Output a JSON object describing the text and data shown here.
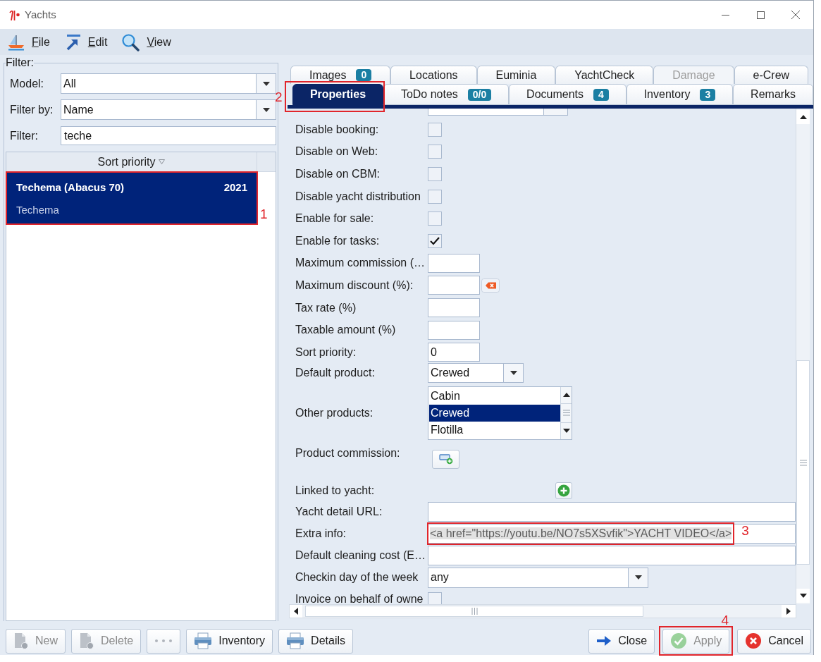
{
  "window": {
    "title": "Yachts"
  },
  "menu": [
    {
      "label": "File",
      "mnemonic": true
    },
    {
      "label": "Edit",
      "mnemonic": true
    },
    {
      "label": "View",
      "mnemonic": true
    }
  ],
  "filter": {
    "title": "Filter:",
    "fields": [
      {
        "kind": "dropdown",
        "label": "Model:",
        "value": "All"
      },
      {
        "kind": "dropdown",
        "label": "Filter by:",
        "value": "Name"
      },
      {
        "kind": "text",
        "label": "Filter:",
        "value": "teche"
      }
    ]
  },
  "yacht_list": {
    "columns": [
      {
        "label": "Sort priority",
        "sorted": true
      }
    ],
    "rows": [
      {
        "name": "Techema (Abacus 70)",
        "year": "2021",
        "subtitle": "Techema",
        "selected": true,
        "callout": "1"
      }
    ]
  },
  "tabs": {
    "back_row": [
      {
        "label": "Images",
        "badge": "0",
        "selected": false,
        "disabled": false
      },
      {
        "label": "Locations",
        "selected": false,
        "disabled": false
      },
      {
        "label": "Euminia",
        "selected": false,
        "disabled": false
      },
      {
        "label": "YachtCheck",
        "selected": false,
        "disabled": false
      },
      {
        "label": "Damage",
        "selected": false,
        "disabled": true
      },
      {
        "label": "e-Crew",
        "selected": false,
        "disabled": false
      }
    ],
    "front_row": [
      {
        "label": "Properties",
        "selected": true,
        "disabled": false,
        "callout": "2"
      },
      {
        "label": "ToDo notes",
        "badge": "0/0",
        "selected": false,
        "disabled": false
      },
      {
        "label": "Documents",
        "badge": "4",
        "selected": false,
        "disabled": false
      },
      {
        "label": "Inventory",
        "badge": "3",
        "selected": false,
        "disabled": false
      },
      {
        "label": "Remarks",
        "selected": false,
        "disabled": false
      }
    ]
  },
  "properties": [
    {
      "kind": "checkbox",
      "label": "Disable booking:",
      "checked": false
    },
    {
      "kind": "checkbox",
      "label": "Disable on Web:",
      "checked": false
    },
    {
      "kind": "checkbox",
      "label": "Disable on CBM:",
      "checked": false
    },
    {
      "kind": "checkbox",
      "label": "Disable yacht distribution",
      "checked": false
    },
    {
      "kind": "checkbox",
      "label": "Enable for sale:",
      "checked": false
    },
    {
      "kind": "checkbox",
      "label": "Enable for tasks:",
      "checked": true
    },
    {
      "kind": "short_field",
      "label": "Maximum commission (…"
    },
    {
      "kind": "short_field",
      "label": "Maximum discount (%):",
      "clear_button": true
    },
    {
      "kind": "short_field",
      "label": "Tax rate (%)"
    },
    {
      "kind": "short_field",
      "label": "Taxable amount (%)"
    },
    {
      "kind": "short_field",
      "label": "Sort priority:",
      "value": "0"
    },
    {
      "kind": "short_dropdown",
      "label": "Default product:",
      "value": "Crewed"
    },
    {
      "kind": "listbox",
      "label": "Other products:",
      "options": [
        {
          "label": "Cabin",
          "selected": false
        },
        {
          "label": "Crewed",
          "selected": true
        },
        {
          "label": "Flotilla",
          "selected": false
        }
      ]
    },
    {
      "kind": "icon_button",
      "label": "Product commission:"
    },
    {
      "kind": "add_button",
      "label": "Linked to yacht:"
    },
    {
      "kind": "long_field",
      "label": "Yacht detail URL:"
    },
    {
      "kind": "long_field",
      "label": "Extra info:",
      "value": "<a href=\"https://youtu.be/NO7s5XSvfik\">YACHT VIDEO</a>",
      "text_selected": true,
      "callout": "3"
    },
    {
      "kind": "long_field",
      "label": "Default cleaning cost (E…"
    },
    {
      "kind": "long_dropdown",
      "label": "Checkin day of the week",
      "value": "any"
    },
    {
      "kind": "checkbox",
      "label": "Invoice on behalf of owne",
      "checked": false
    }
  ],
  "actions_left": [
    {
      "label": "New",
      "disabled": true
    },
    {
      "label": "Delete",
      "disabled": true
    },
    {
      "disabled": true
    },
    {
      "label": "Inventory",
      "disabled": false
    },
    {
      "label": "Details",
      "disabled": false
    }
  ],
  "actions_right": [
    {
      "label": "Close",
      "disabled": false
    },
    {
      "label": "Apply",
      "disabled": true,
      "callout": "4"
    },
    {
      "label": "Cancel",
      "disabled": false
    }
  ]
}
